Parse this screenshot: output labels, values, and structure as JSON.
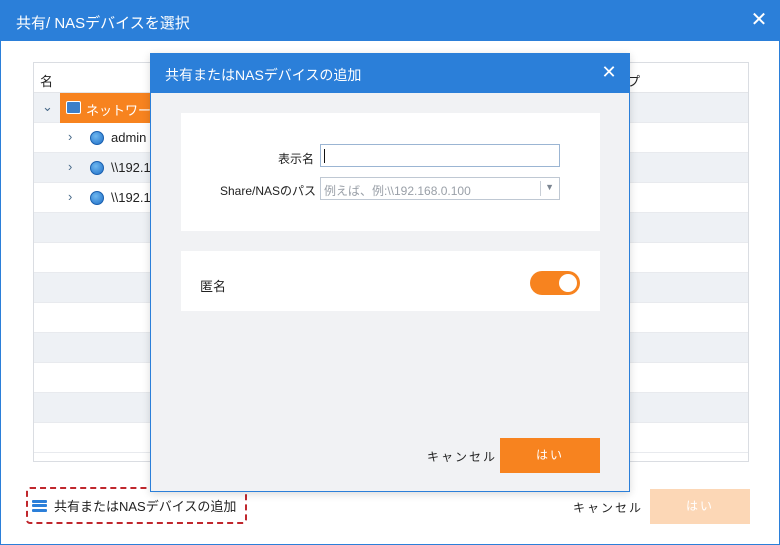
{
  "outer": {
    "title": "共有/ NASデバイスを選択",
    "close_symbol": "✕",
    "columns": {
      "name": "名",
      "type": "プ"
    },
    "tree": {
      "root_label": "ネットワー",
      "children": [
        {
          "label": "admin"
        },
        {
          "label": "\\\\192.1"
        },
        {
          "label": "\\\\192.1"
        }
      ]
    },
    "add_device_label": "共有またはNASデバイスの追加",
    "cancel_label": "キャンセル",
    "ok_label": "はい"
  },
  "dialog": {
    "title": "共有またはNASデバイスの追加",
    "close_symbol": "✕",
    "display_name_label": "表示名",
    "display_name_value": "",
    "path_label": "Share/NASのパス",
    "path_placeholder": "例えば、例:\\\\192.168.0.100",
    "anonymous_label": "匿名",
    "anonymous_enabled": true,
    "cancel_label": "キャンセル",
    "ok_label": "はい"
  },
  "colors": {
    "accent_blue": "#2b7fd9",
    "accent_orange": "#f7831f",
    "disabled_orange": "#fcd7b6",
    "highlight_red_dashed": "#c0272d"
  }
}
